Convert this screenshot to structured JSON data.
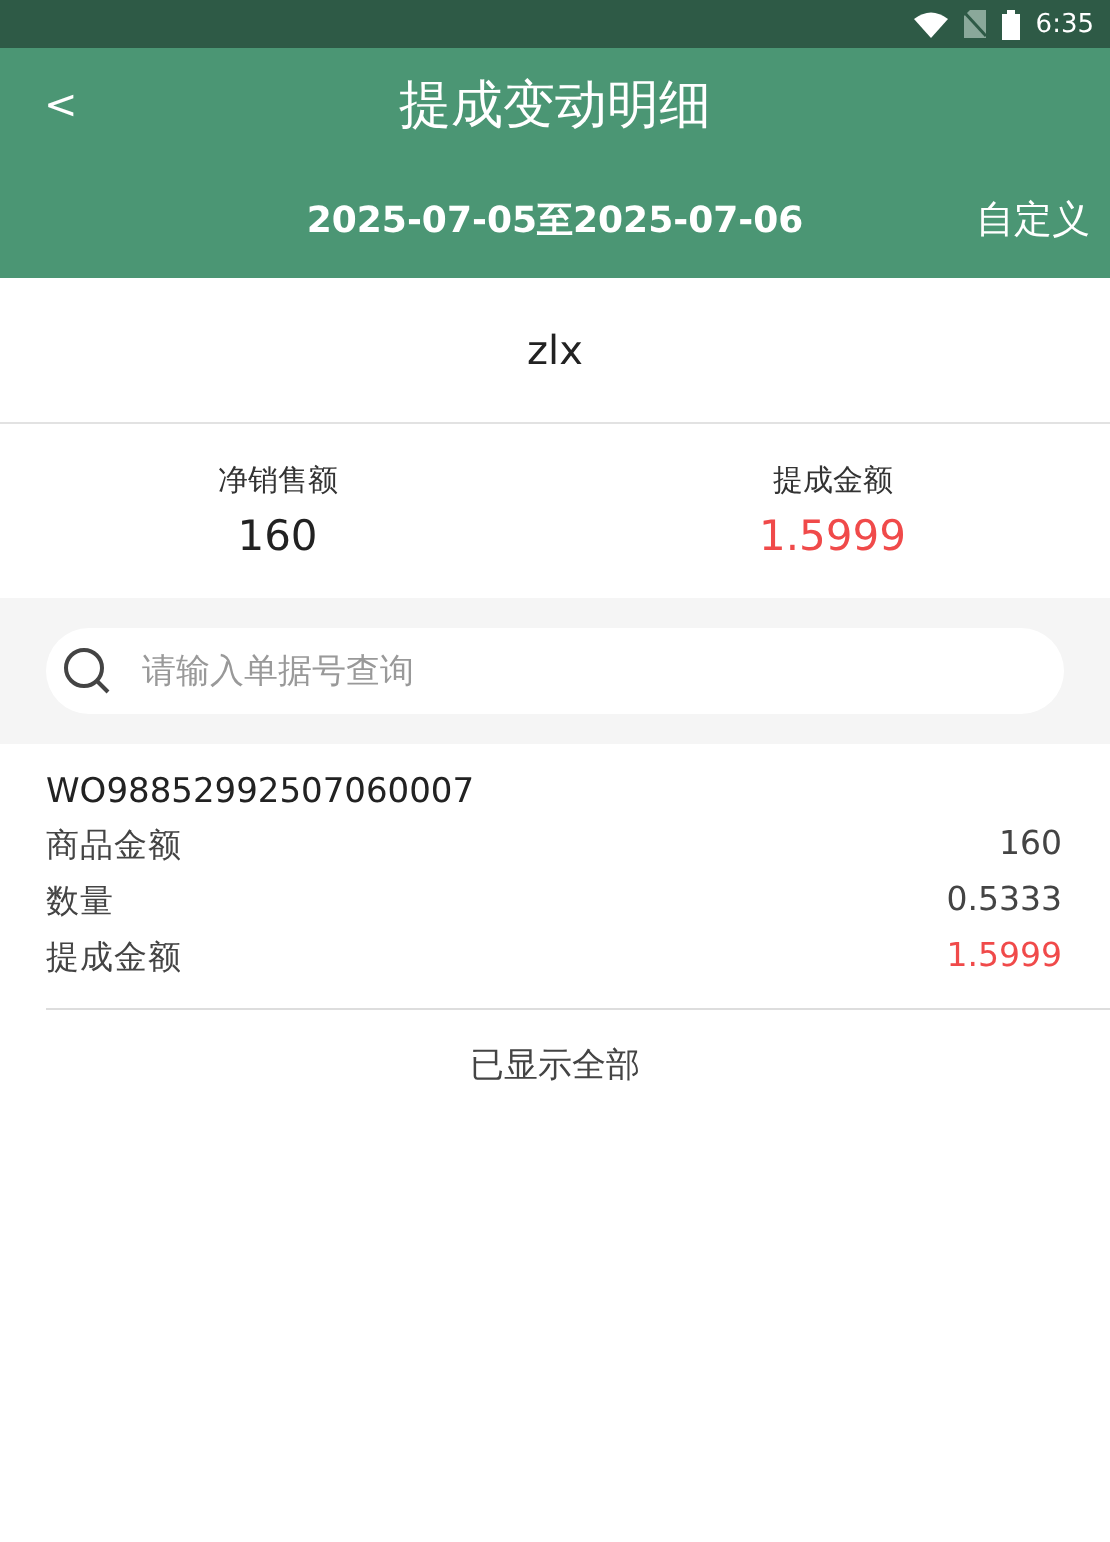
{
  "status_bar": {
    "time": "6:35"
  },
  "header": {
    "back": "<",
    "title": "提成变动明细",
    "date_range": "2025-07-05至2025-07-06",
    "custom_button": "自定义"
  },
  "person": "zlx",
  "summary": [
    {
      "label": "净销售额",
      "value": "160",
      "emphasis": false
    },
    {
      "label": "提成金额",
      "value": "1.5999",
      "emphasis": true
    }
  ],
  "search": {
    "placeholder": "请输入单据号查询"
  },
  "records": [
    {
      "number": "WO98852992507060007",
      "fields": [
        {
          "label": "商品金额",
          "value": "160",
          "emphasis": false
        },
        {
          "label": "数量",
          "value": "0.5333",
          "emphasis": false
        },
        {
          "label": "提成金额",
          "value": "1.5999",
          "emphasis": true
        }
      ]
    }
  ],
  "footer": "已显示全部"
}
